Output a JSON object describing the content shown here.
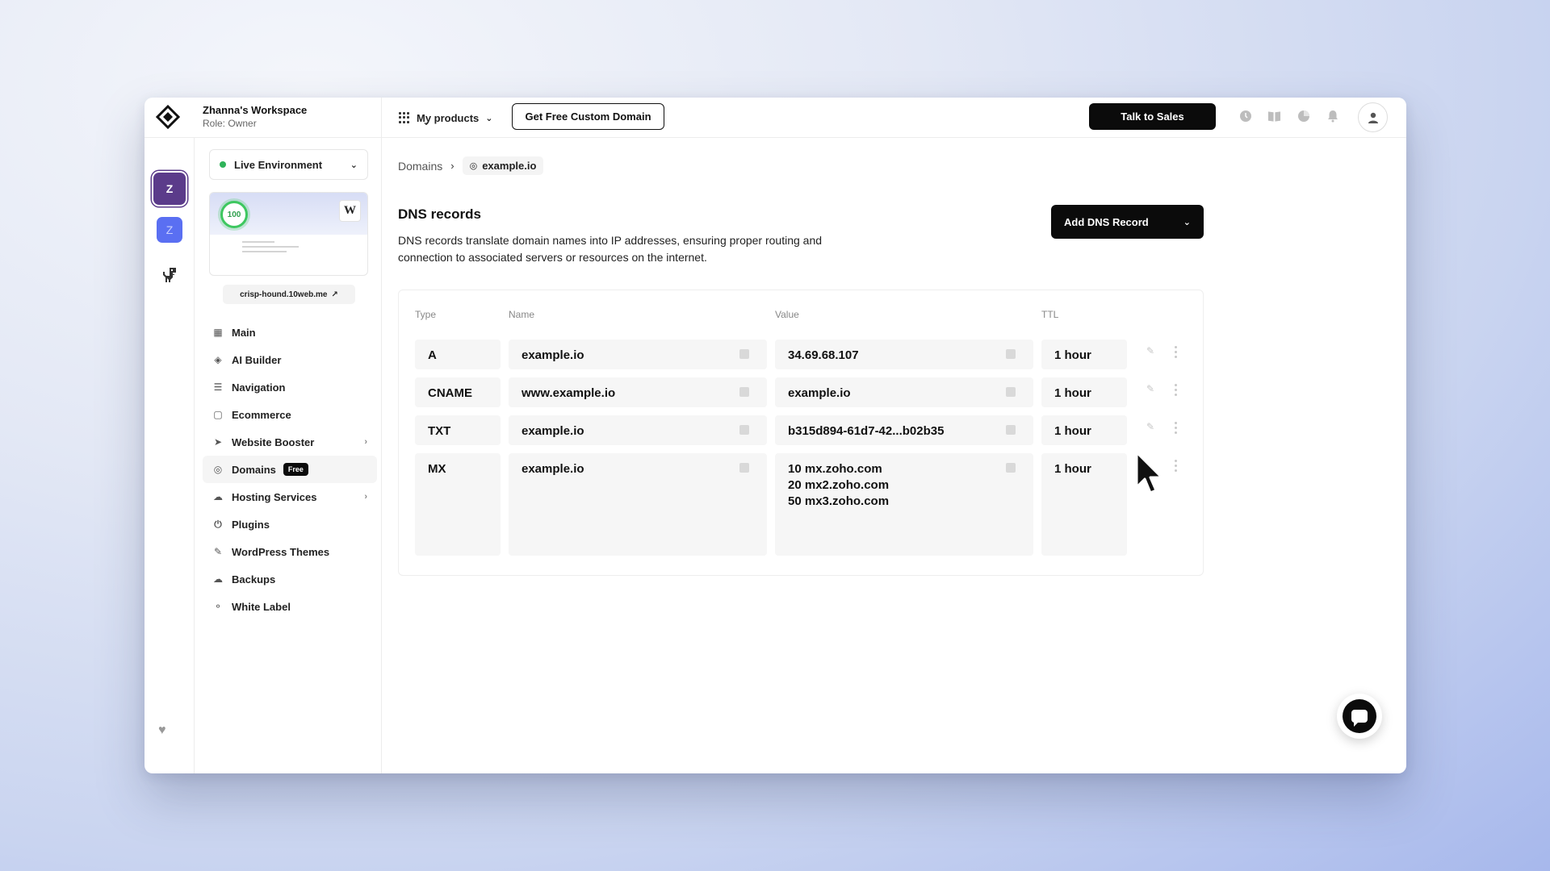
{
  "header": {
    "workspace_name": "Zhanna's Workspace",
    "workspace_role": "Role: Owner",
    "my_products": "My products",
    "free_domain_button": "Get Free Custom Domain",
    "talk_to_sales_button": "Talk to Sales"
  },
  "rail": {
    "site1_initial": "Z",
    "site2_initial": "Z"
  },
  "sidebar": {
    "environment": "Live Environment",
    "performance_score": "100",
    "wp_badge": "W",
    "site_url": "crisp-hound.10web.me",
    "items": [
      {
        "label": "Main",
        "icon": "grid-icon"
      },
      {
        "label": "AI Builder",
        "icon": "layers-icon"
      },
      {
        "label": "Navigation",
        "icon": "menu-icon"
      },
      {
        "label": "Ecommerce",
        "icon": "bag-icon"
      },
      {
        "label": "Website Booster",
        "icon": "rocket-icon"
      },
      {
        "label": "Domains",
        "icon": "globe-icon",
        "badge": "Free"
      },
      {
        "label": "Hosting Services",
        "icon": "cloud-icon"
      },
      {
        "label": "Plugins",
        "icon": "plug-icon"
      },
      {
        "label": "WordPress Themes",
        "icon": "brush-icon"
      },
      {
        "label": "Backups",
        "icon": "cloud-backup-icon"
      },
      {
        "label": "White Label",
        "icon": "tag-icon"
      }
    ]
  },
  "breadcrumb": {
    "parent": "Domains",
    "current": "example.io"
  },
  "main": {
    "title": "DNS records",
    "description": "DNS records translate domain names into IP addresses, ensuring proper routing and connection to associated servers or resources on the internet.",
    "add_button": "Add DNS Record"
  },
  "table": {
    "headers": {
      "type": "Type",
      "name": "Name",
      "value": "Value",
      "ttl": "TTL"
    },
    "rows": [
      {
        "type": "A",
        "name": "example.io",
        "value": "34.69.68.107",
        "ttl": "1 hour"
      },
      {
        "type": "CNAME",
        "name": "www.example.io",
        "value": "example.io",
        "ttl": "1 hour"
      },
      {
        "type": "TXT",
        "name": "example.io",
        "value": "b315d894-61d7-42...b02b35",
        "ttl": "1 hour"
      },
      {
        "type": "MX",
        "name": "example.io",
        "value_lines": [
          "10 mx.zoho.com",
          "20 mx2.zoho.com",
          "50 mx3.zoho.com"
        ],
        "ttl": "1 hour"
      }
    ]
  },
  "colors": {
    "accent_dark": "#0b0b0b",
    "site_purple": "#5b3b8a",
    "site_blue": "#5a6ff2",
    "live_green": "#2fb35a"
  }
}
